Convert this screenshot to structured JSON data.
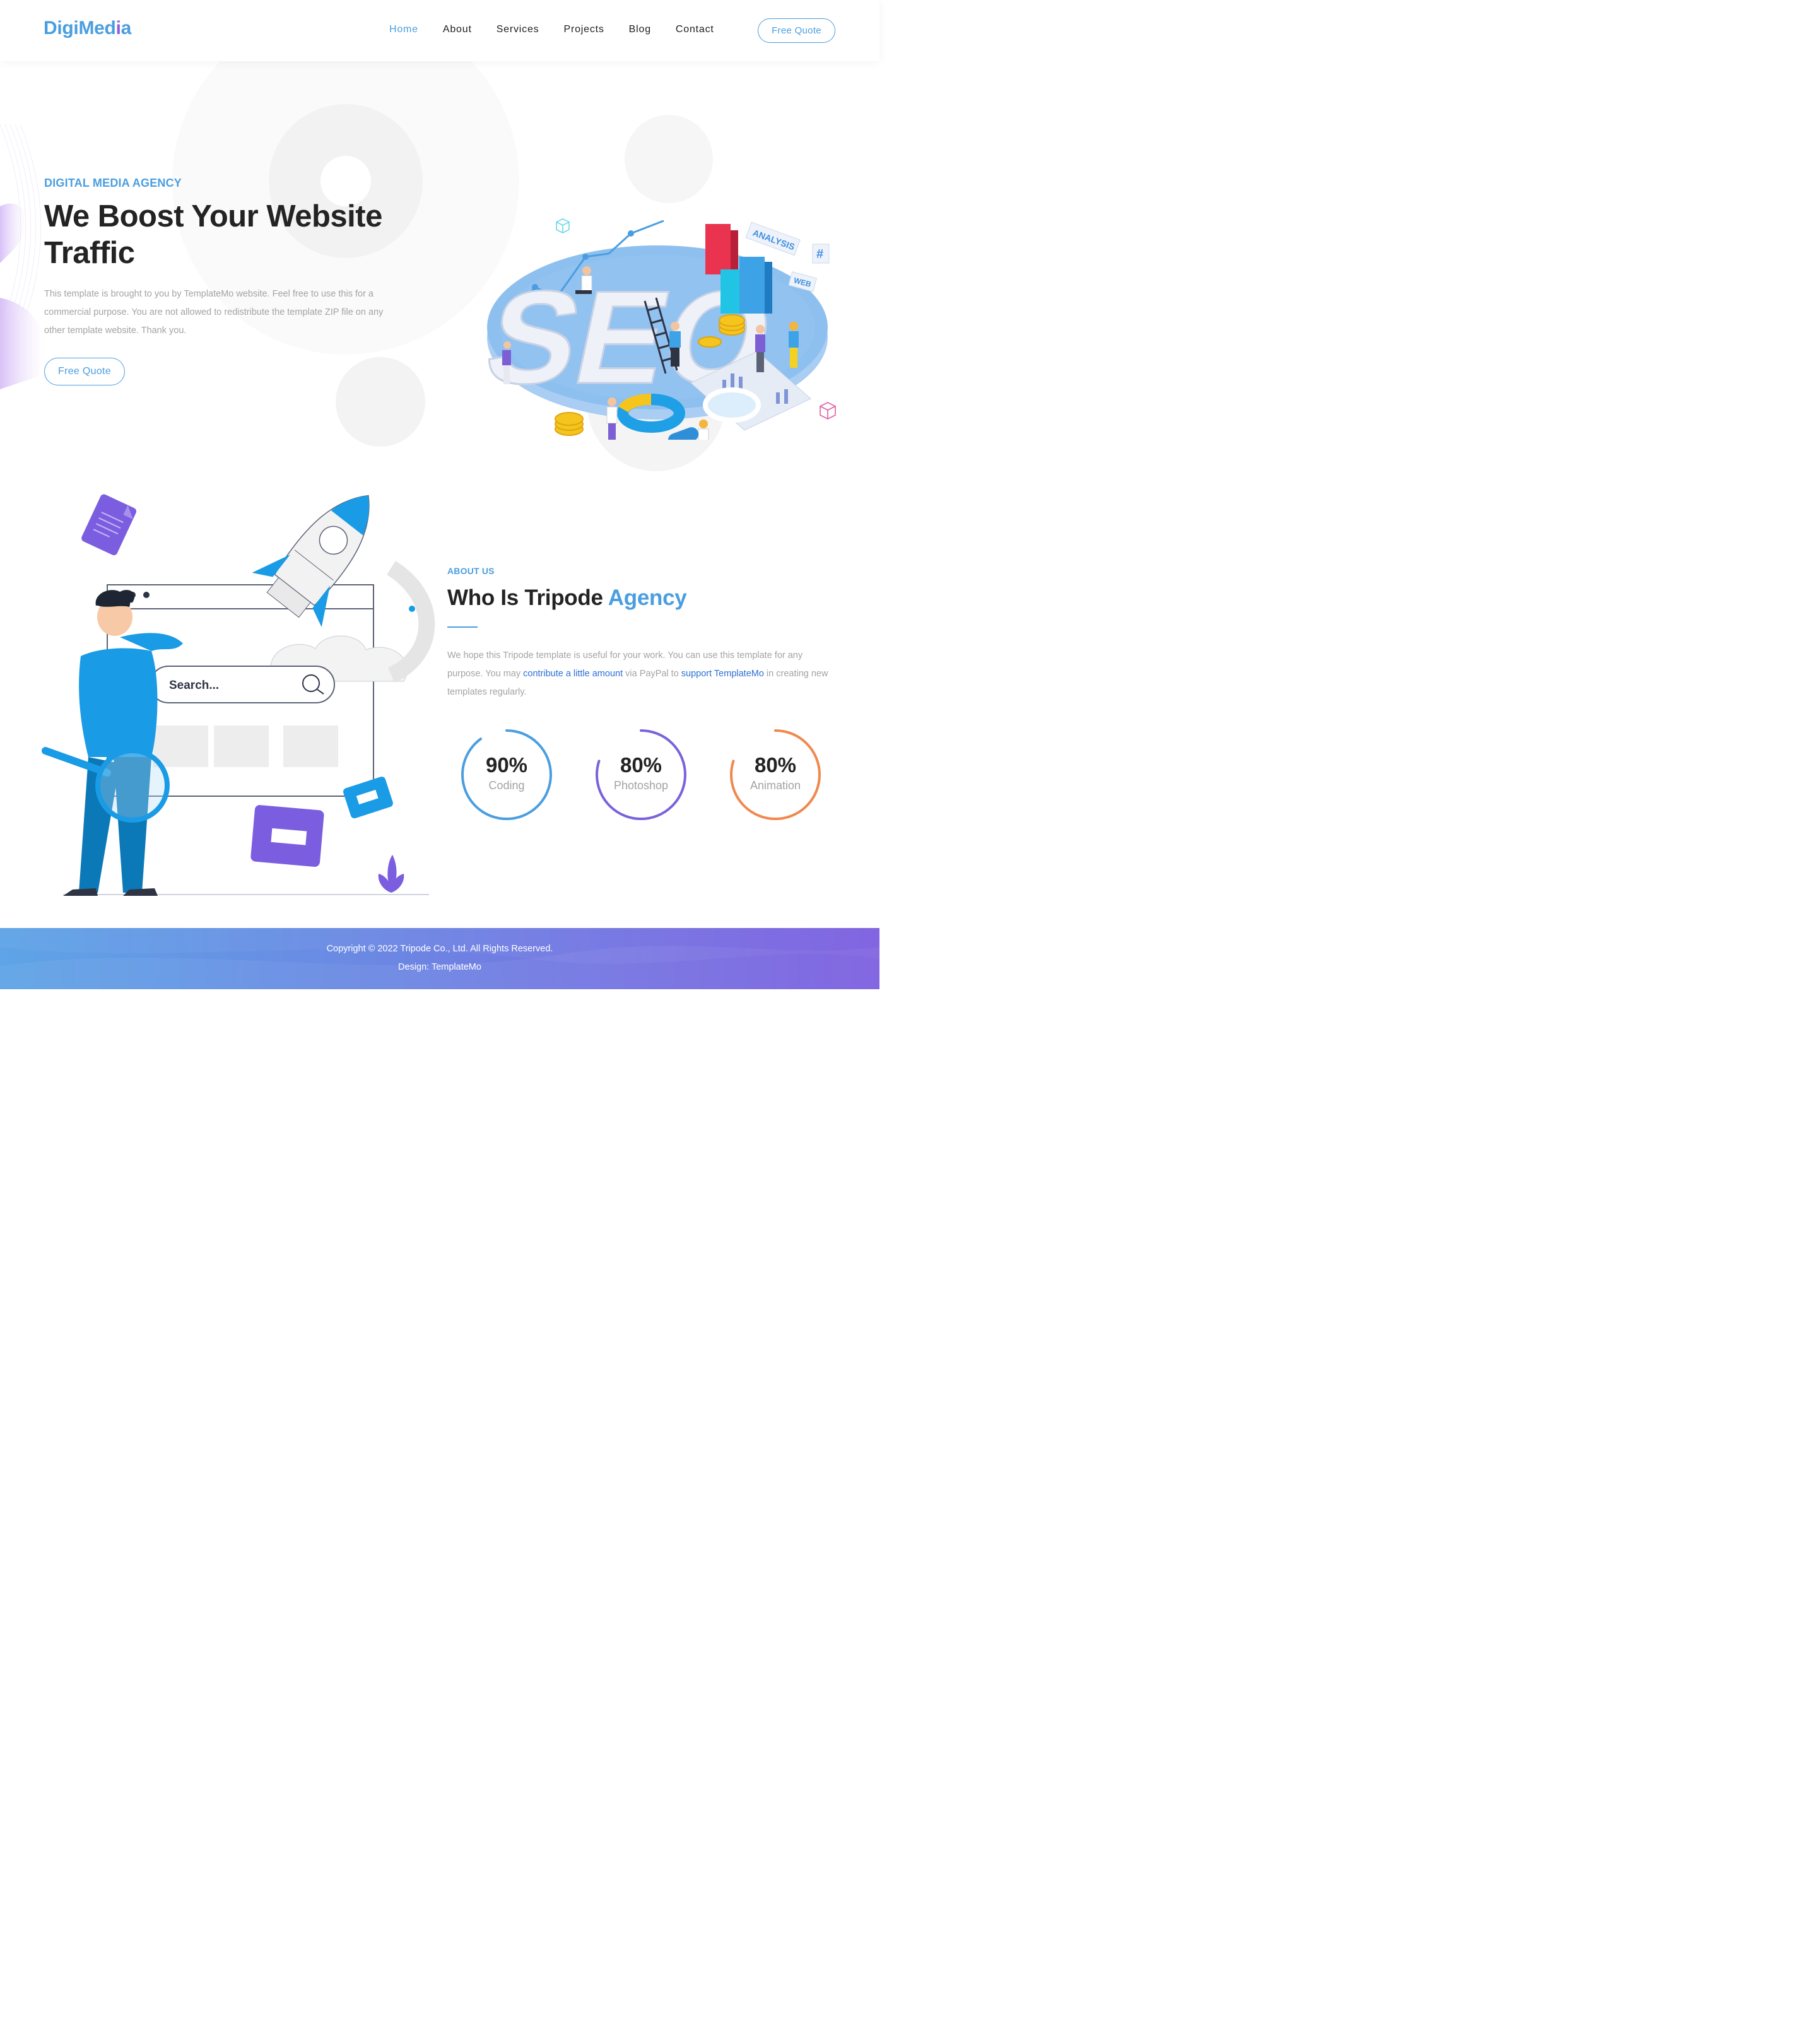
{
  "header": {
    "logo_main": "DigiMed",
    "logo_accent": "i",
    "logo_tail": "a",
    "nav": [
      {
        "label": "Home",
        "active": true
      },
      {
        "label": "About",
        "active": false
      },
      {
        "label": "Services",
        "active": false
      },
      {
        "label": "Projects",
        "active": false
      },
      {
        "label": "Blog",
        "active": false
      },
      {
        "label": "Contact",
        "active": false
      }
    ],
    "cta_label": "Free Quote"
  },
  "hero": {
    "eyebrow": "DIGITAL MEDIA AGENCY",
    "title_line1": "We Boost Your Website",
    "title_line2": "Traffic",
    "description": "This template is brought to you by TemplateMo website. Feel free to use this for a commercial purpose. You are not allowed to redistribute the template ZIP file on any other template website. Thank you.",
    "button_label": "Free Quote",
    "illustration": {
      "seo_text": "SEO",
      "tag_analysis": "ANALYSIS",
      "tag_web": "WEB",
      "tag_hash": "#"
    }
  },
  "about": {
    "label": "ABOUT US",
    "title_prefix": "Who Is Tripode ",
    "title_highlight": "Agency",
    "desc_part1": "We hope this Tripode template is useful for your work. You can use this template for any purpose. You may ",
    "link1": "contribute a little amount",
    "desc_part2": " via PayPal to ",
    "link2": "support TemplateMo",
    "desc_part3": " in creating new templates regularly.",
    "illustration": {
      "search_placeholder": "Search..."
    },
    "skills": [
      {
        "value": "90%",
        "name": "Coding",
        "fraction": 0.9,
        "color": "#4a9ee0"
      },
      {
        "value": "80%",
        "name": "Photoshop",
        "fraction": 0.8,
        "color": "#7a62dc"
      },
      {
        "value": "80%",
        "name": "Animation",
        "fraction": 0.8,
        "color": "#f0884f"
      }
    ]
  },
  "footer": {
    "copyright": "Copyright © 2022 Tripode Co., Ltd. All Rights Reserved.",
    "design": "Design: TemplateMo"
  },
  "colors": {
    "primary": "#4a9ee0",
    "purple": "#7a62dc",
    "orange": "#f0884f",
    "heading": "#232323",
    "muted": "#a3a3a3"
  }
}
